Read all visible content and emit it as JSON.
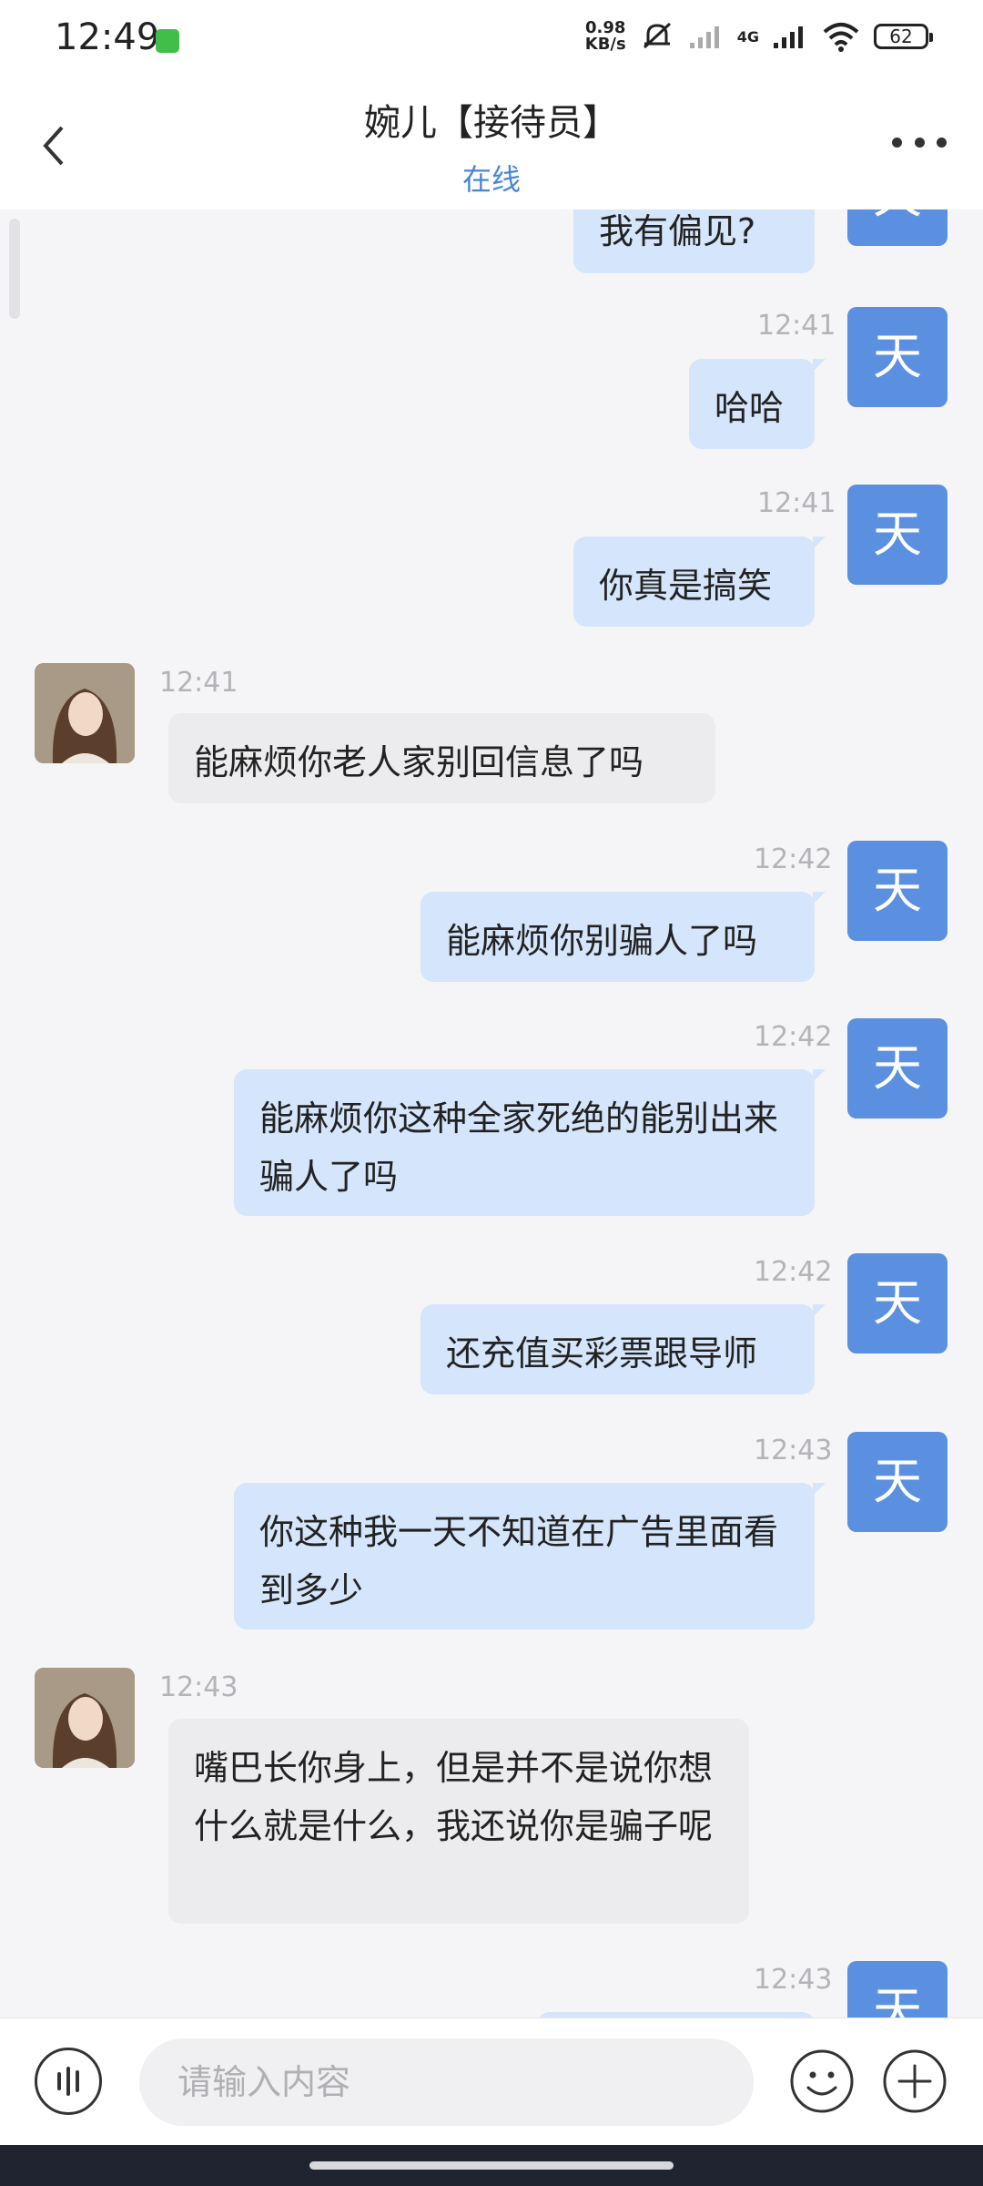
{
  "status_bar": {
    "time": "12:49",
    "net_speed_value": "0.98",
    "net_speed_unit": "KB/s",
    "network_type": "4G",
    "battery": "62"
  },
  "header": {
    "title": "婉儿【接待员】",
    "status": "在线"
  },
  "me_avatar_text": "天",
  "messages": [
    {
      "sender": "me",
      "time": "",
      "text": "我有偏见?"
    },
    {
      "sender": "me",
      "time": "12:41",
      "text": "哈哈"
    },
    {
      "sender": "me",
      "time": "12:41",
      "text": "你真是搞笑"
    },
    {
      "sender": "her",
      "time": "12:41",
      "text": "能麻烦你老人家别回信息了吗"
    },
    {
      "sender": "me",
      "time": "12:42",
      "text": "能麻烦你别骗人了吗"
    },
    {
      "sender": "me",
      "time": "12:42",
      "text": "能麻烦你这种全家死绝的能别出来骗人了吗"
    },
    {
      "sender": "me",
      "time": "12:42",
      "text": "还充值买彩票跟导师"
    },
    {
      "sender": "me",
      "time": "12:43",
      "text": "你这种我一天不知道在广告里面看到多少"
    },
    {
      "sender": "her",
      "time": "12:43",
      "text": "嘴巴长你身上，但是并不是说你想什么就是什么，我还说你是骗子呢"
    },
    {
      "sender": "me",
      "time": "12:43",
      "text": ""
    }
  ],
  "input": {
    "placeholder": "请输入内容",
    "value": ""
  }
}
